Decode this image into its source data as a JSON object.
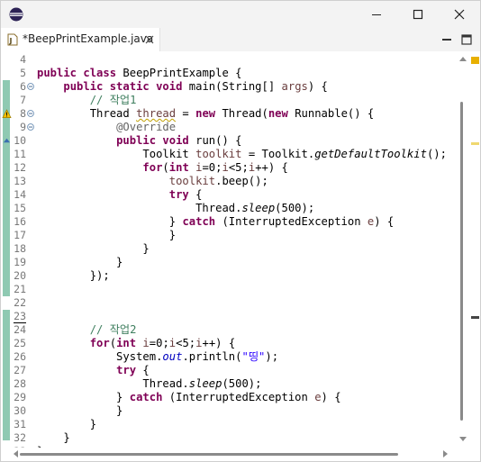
{
  "window": {
    "icon": "eclipse-icon",
    "buttons": [
      "minimize-icon",
      "maximize-icon",
      "close-icon"
    ]
  },
  "tab": {
    "title": "*BeepPrintExample.java",
    "icon": "java-file-icon"
  },
  "editor": {
    "lines": [
      {
        "num": "4",
        "segments": []
      },
      {
        "num": "5",
        "segments": [
          {
            "t": "public class ",
            "c": "kw"
          },
          {
            "t": "BeepPrintExample {",
            "c": ""
          }
        ]
      },
      {
        "num": "6",
        "fold": true,
        "segments": [
          {
            "t": "    ",
            "c": ""
          },
          {
            "t": "public static void ",
            "c": "kw"
          },
          {
            "t": "main(String[] ",
            "c": ""
          },
          {
            "t": "args",
            "c": "fld"
          },
          {
            "t": ") {",
            "c": ""
          }
        ]
      },
      {
        "num": "7",
        "segments": [
          {
            "t": "        ",
            "c": ""
          },
          {
            "t": "// 작업1",
            "c": "cm"
          }
        ]
      },
      {
        "num": "8",
        "fold": true,
        "warning": true,
        "segments": [
          {
            "t": "        Thread ",
            "c": ""
          },
          {
            "t": "thread",
            "c": "fld warn-ul"
          },
          {
            "t": " = ",
            "c": ""
          },
          {
            "t": "new ",
            "c": "kw"
          },
          {
            "t": "Thread(",
            "c": ""
          },
          {
            "t": "new ",
            "c": "kw"
          },
          {
            "t": "Runnable() {",
            "c": ""
          }
        ]
      },
      {
        "num": "9",
        "fold": true,
        "segments": [
          {
            "t": "            ",
            "c": ""
          },
          {
            "t": "@Override",
            "c": "an"
          }
        ]
      },
      {
        "num": "10",
        "override": true,
        "segments": [
          {
            "t": "            ",
            "c": ""
          },
          {
            "t": "public void ",
            "c": "kw"
          },
          {
            "t": "run() {",
            "c": ""
          }
        ]
      },
      {
        "num": "11",
        "segments": [
          {
            "t": "                Toolkit ",
            "c": ""
          },
          {
            "t": "toolkit",
            "c": "fld"
          },
          {
            "t": " = Toolkit.",
            "c": ""
          },
          {
            "t": "getDefaultToolkit",
            "c": "it"
          },
          {
            "t": "();",
            "c": ""
          }
        ]
      },
      {
        "num": "12",
        "segments": [
          {
            "t": "                ",
            "c": ""
          },
          {
            "t": "for",
            "c": "kw"
          },
          {
            "t": "(",
            "c": ""
          },
          {
            "t": "int ",
            "c": "kw"
          },
          {
            "t": "i",
            "c": "fld"
          },
          {
            "t": "=0;",
            "c": ""
          },
          {
            "t": "i",
            "c": "fld"
          },
          {
            "t": "<5;",
            "c": ""
          },
          {
            "t": "i",
            "c": "fld"
          },
          {
            "t": "++) {",
            "c": ""
          }
        ]
      },
      {
        "num": "13",
        "segments": [
          {
            "t": "                    ",
            "c": ""
          },
          {
            "t": "toolkit",
            "c": "fld"
          },
          {
            "t": ".beep();",
            "c": ""
          }
        ]
      },
      {
        "num": "14",
        "segments": [
          {
            "t": "                    ",
            "c": ""
          },
          {
            "t": "try ",
            "c": "kw"
          },
          {
            "t": "{",
            "c": ""
          }
        ]
      },
      {
        "num": "15",
        "segments": [
          {
            "t": "                        Thread.",
            "c": ""
          },
          {
            "t": "sleep",
            "c": "it"
          },
          {
            "t": "(500);",
            "c": ""
          }
        ]
      },
      {
        "num": "16",
        "segments": [
          {
            "t": "                    } ",
            "c": ""
          },
          {
            "t": "catch ",
            "c": "kw"
          },
          {
            "t": "(InterruptedException ",
            "c": ""
          },
          {
            "t": "e",
            "c": "fld"
          },
          {
            "t": ") {",
            "c": ""
          }
        ]
      },
      {
        "num": "17",
        "segments": [
          {
            "t": "                    }",
            "c": ""
          }
        ]
      },
      {
        "num": "18",
        "segments": [
          {
            "t": "                }",
            "c": ""
          }
        ]
      },
      {
        "num": "19",
        "segments": [
          {
            "t": "            }",
            "c": ""
          }
        ]
      },
      {
        "num": "20",
        "segments": [
          {
            "t": "        });",
            "c": ""
          }
        ]
      },
      {
        "num": "21",
        "segments": []
      },
      {
        "num": "22",
        "segments": []
      },
      {
        "num": "23",
        "segments": []
      },
      {
        "num": "24",
        "segments": [
          {
            "t": "        ",
            "c": ""
          },
          {
            "t": "// 작업2",
            "c": "cm"
          }
        ]
      },
      {
        "num": "25",
        "segments": [
          {
            "t": "        ",
            "c": ""
          },
          {
            "t": "for",
            "c": "kw"
          },
          {
            "t": "(",
            "c": ""
          },
          {
            "t": "int ",
            "c": "kw"
          },
          {
            "t": "i",
            "c": "fld"
          },
          {
            "t": "=0;",
            "c": ""
          },
          {
            "t": "i",
            "c": "fld"
          },
          {
            "t": "<5;",
            "c": ""
          },
          {
            "t": "i",
            "c": "fld"
          },
          {
            "t": "++) {",
            "c": ""
          }
        ]
      },
      {
        "num": "26",
        "segments": [
          {
            "t": "            System.",
            "c": ""
          },
          {
            "t": "out",
            "c": "sf"
          },
          {
            "t": ".println(",
            "c": ""
          },
          {
            "t": "\"띵\"",
            "c": "st"
          },
          {
            "t": ");",
            "c": ""
          }
        ]
      },
      {
        "num": "27",
        "segments": [
          {
            "t": "            ",
            "c": ""
          },
          {
            "t": "try ",
            "c": "kw"
          },
          {
            "t": "{",
            "c": ""
          }
        ]
      },
      {
        "num": "28",
        "segments": [
          {
            "t": "                Thread.",
            "c": ""
          },
          {
            "t": "sleep",
            "c": "it"
          },
          {
            "t": "(500);",
            "c": ""
          }
        ]
      },
      {
        "num": "29",
        "segments": [
          {
            "t": "            } ",
            "c": ""
          },
          {
            "t": "catch ",
            "c": "kw"
          },
          {
            "t": "(InterruptedException ",
            "c": ""
          },
          {
            "t": "e",
            "c": "fld"
          },
          {
            "t": ") {",
            "c": ""
          }
        ]
      },
      {
        "num": "30",
        "segments": [
          {
            "t": "            }",
            "c": ""
          }
        ]
      },
      {
        "num": "31",
        "segments": [
          {
            "t": "        }",
            "c": ""
          }
        ]
      },
      {
        "num": "32",
        "segments": [
          {
            "t": "    }",
            "c": ""
          }
        ]
      },
      {
        "num": "33",
        "segments": [
          {
            "t": "}",
            "c": ""
          }
        ]
      }
    ]
  },
  "colors": {
    "keyword": "#7f0055",
    "comment": "#3f7f5f",
    "annotation": "#646464",
    "field": "#6a3e3e",
    "string": "#2a00ff",
    "change_bar": "#8fc9b2",
    "warning": "#e8b000"
  }
}
